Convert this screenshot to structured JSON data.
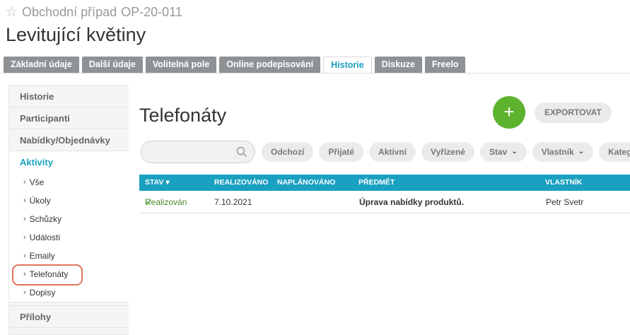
{
  "header": {
    "subtitle": "Obchodní případ",
    "case_id": "OP-20-011",
    "title": "Levitující květiny"
  },
  "tabs": [
    {
      "label": "Základní údaje",
      "active": false
    },
    {
      "label": "Další údaje",
      "active": false
    },
    {
      "label": "Volitelná pole",
      "active": false
    },
    {
      "label": "Online podepisování",
      "active": false
    },
    {
      "label": "Historie",
      "active": true
    },
    {
      "label": "Diskuze",
      "active": false
    },
    {
      "label": "Freelo",
      "active": false
    }
  ],
  "sidebar": {
    "sections": [
      "Historie",
      "Participanti",
      "Nabídky/Objednávky"
    ],
    "active_section": "Aktivity",
    "sub_items": [
      "Vše",
      "Úkoly",
      "Schůzky",
      "Události",
      "Emaily",
      "Telefonáty",
      "Dopisy"
    ],
    "highlighted_item": "Telefonáty",
    "bottom_section": "Přílohy"
  },
  "main": {
    "title": "Telefonáty",
    "add_label": "+",
    "export_label": "EXPORTOVAT",
    "search_placeholder": ""
  },
  "filters": [
    {
      "label": "Odchozí",
      "dropdown": false
    },
    {
      "label": "Přijaté",
      "dropdown": false
    },
    {
      "label": "Aktivní",
      "dropdown": false
    },
    {
      "label": "Vyřízené",
      "dropdown": false
    },
    {
      "label": "Stav",
      "dropdown": true
    },
    {
      "label": "Vlastník",
      "dropdown": true
    },
    {
      "label": "Kategorie",
      "dropdown": false
    }
  ],
  "table": {
    "columns": [
      "STAV",
      "REALIZOVÁNO",
      "NAPLÁNOVÁNO",
      "PŘEDMĚT",
      "VLASTNÍK"
    ],
    "rows": [
      {
        "status": "Realizován",
        "realized": "7.10.2021",
        "planned": "",
        "subject": "Úprava nabídky produktů.",
        "owner": "Petr Svetr"
      }
    ]
  },
  "colors": {
    "accent": "#1aa0c0",
    "tab_inactive": "#8f9294",
    "add_button": "#5db22e",
    "highlight_ring": "#e2735a"
  }
}
